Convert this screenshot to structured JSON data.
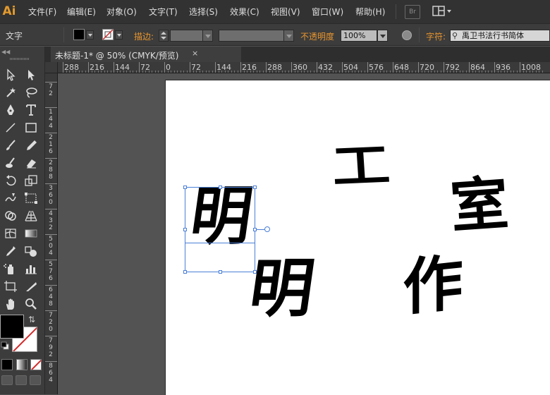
{
  "app": {
    "logo": "Ai"
  },
  "menu": [
    "文件(F)",
    "编辑(E)",
    "对象(O)",
    "文字(T)",
    "选择(S)",
    "效果(C)",
    "视图(V)",
    "窗口(W)",
    "帮助(H)"
  ],
  "menubar_extra": {
    "bridge": "Br",
    "arrange_icon": "arrange-documents-icon"
  },
  "control_bar": {
    "selection_type": "文字",
    "stroke_label": "描边:",
    "opacity_label": "不透明度",
    "opacity_value": "100%",
    "char_label": "字符:",
    "font_name": "禹卫书法行书简体"
  },
  "document_tab": {
    "title": "未标题-1* @ 50% (CMYK/预览)",
    "close": "×"
  },
  "ruler_h_labels": [
    "288",
    "216",
    "144",
    "72",
    "0",
    "72",
    "144",
    "216",
    "288",
    "360",
    "432",
    "504",
    "576",
    "648",
    "720",
    "792",
    "864",
    "936",
    "1008"
  ],
  "ruler_v_labels": [
    "7 2",
    "1 4 4",
    "2 1 6",
    "2 8 8",
    "3 6 0",
    "4 3 2",
    "5 0 4",
    "5 7 6",
    "6 4 8",
    "7 2 0",
    "7 9 2",
    "8 6 4"
  ],
  "artboard_glyphs": {
    "ming_selected": "明",
    "gong": "工",
    "shi": "室",
    "ming": "明",
    "zuo": "作"
  },
  "tools": [
    "selection-tool",
    "direct-selection-tool",
    "magic-wand-tool",
    "lasso-tool",
    "pen-tool",
    "type-tool",
    "line-tool",
    "rectangle-tool",
    "paintbrush-tool",
    "pencil-tool",
    "blob-brush-tool",
    "eraser-tool",
    "rotate-tool",
    "scale-tool",
    "warp-tool",
    "free-transform-tool",
    "shape-builder-tool",
    "perspective-grid-tool",
    "mesh-tool",
    "gradient-tool",
    "eyedropper-tool",
    "blend-tool",
    "symbol-sprayer-tool",
    "column-graph-tool",
    "artboard-tool",
    "slice-tool",
    "hand-tool",
    "zoom-tool"
  ],
  "colors": {
    "fill": "#000000",
    "stroke_none": "#ffffff",
    "selection": "#4a7fd8",
    "accent_label": "#e8952e"
  }
}
